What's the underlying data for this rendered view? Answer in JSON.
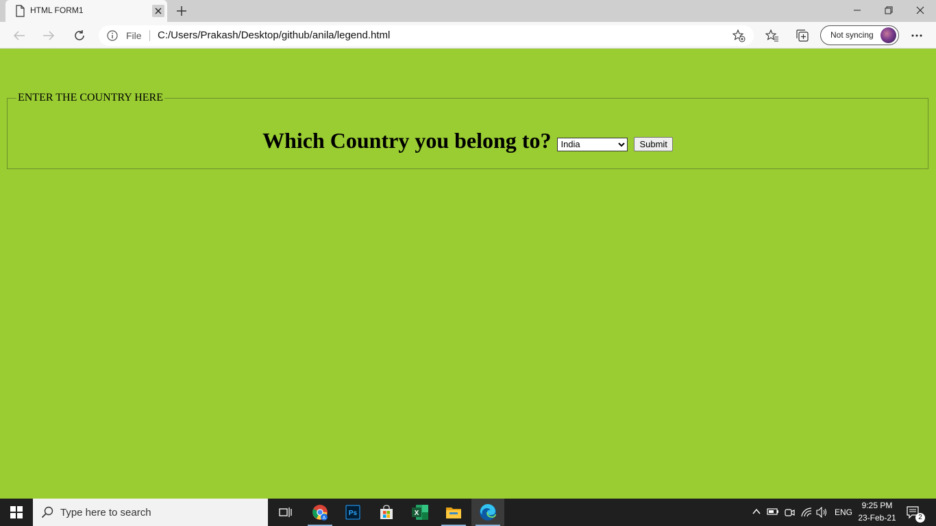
{
  "browser": {
    "tab_title": "HTML FORM1",
    "address_scheme": "File",
    "url": "C:/Users/Prakash/Desktop/github/anila/legend.html",
    "profile_label": "Not syncing"
  },
  "page": {
    "background_color": "#9acd32",
    "legend": "ENTER THE COUNTRY HERE",
    "question": "Which Country you belong to?",
    "select_value": "India",
    "select_options": [
      "India"
    ],
    "submit_label": "Submit"
  },
  "taskbar": {
    "search_placeholder": "Type here to search",
    "apps": [
      "task-view",
      "chrome",
      "photoshop",
      "microsoft-store",
      "excel",
      "file-explorer",
      "edge"
    ],
    "language": "ENG",
    "time": "9:25 PM",
    "date": "23-Feb-21",
    "notification_count": "2"
  }
}
